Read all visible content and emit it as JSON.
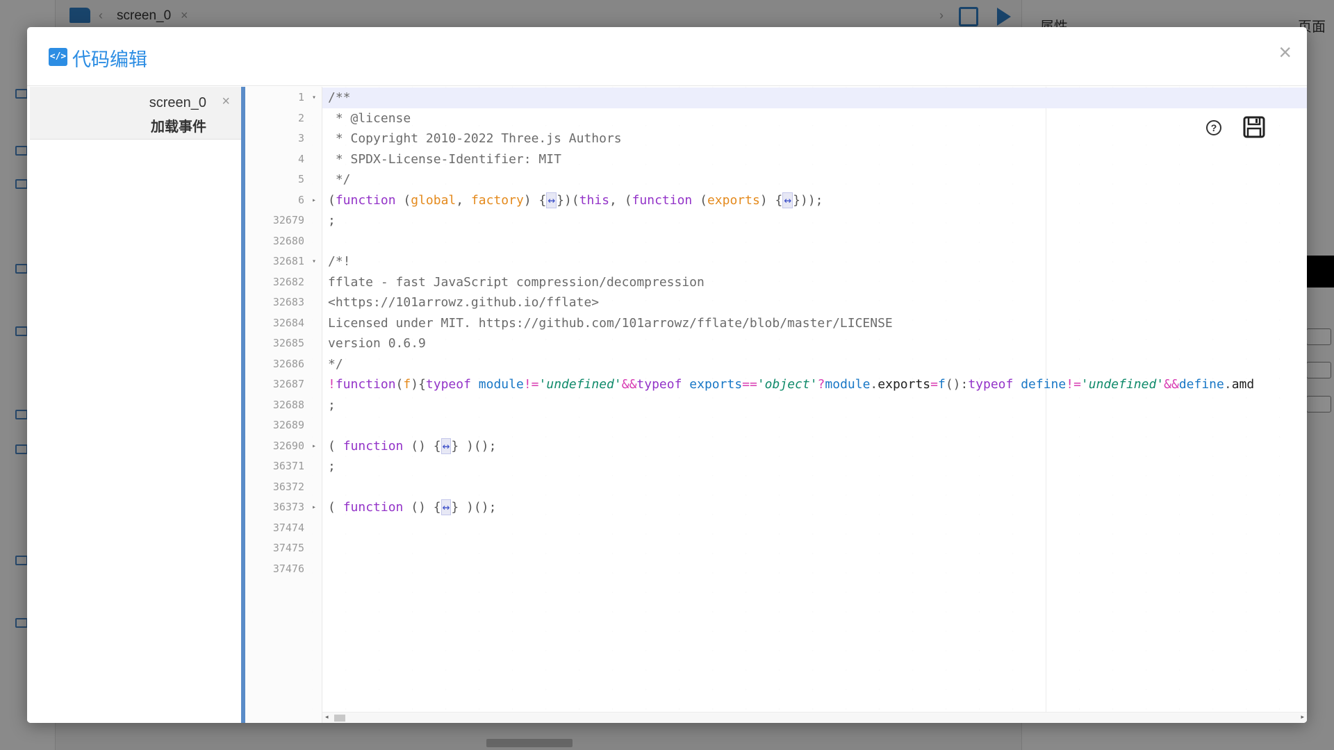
{
  "background_app": {
    "tab_label": "screen_0",
    "right_panel_title": "属性",
    "right_panel_tab": "页面"
  },
  "modal": {
    "title": "代码编辑",
    "title_icon": "code-icon",
    "close_label": "×"
  },
  "script_list": [
    {
      "name": "screen_0",
      "event": "加载事件",
      "close_label": "×"
    }
  ],
  "editor": {
    "lines": [
      {
        "num": "1",
        "fold": "open",
        "tokens": [
          [
            "c-com",
            "/**"
          ]
        ]
      },
      {
        "num": "2",
        "tokens": [
          [
            "c-com",
            " * @license"
          ]
        ]
      },
      {
        "num": "3",
        "tokens": [
          [
            "c-com",
            " * Copyright 2010-2022 Three.js Authors"
          ]
        ]
      },
      {
        "num": "4",
        "tokens": [
          [
            "c-com",
            " * SPDX-License-Identifier: MIT"
          ]
        ]
      },
      {
        "num": "5",
        "tokens": [
          [
            "c-com",
            " */"
          ]
        ]
      },
      {
        "num": "6",
        "fold": "closed",
        "tokens": [
          [
            "c-plain",
            "("
          ],
          [
            "c-kw",
            "function"
          ],
          [
            "c-plain",
            " ("
          ],
          [
            "c-par",
            "global"
          ],
          [
            "c-plain",
            ", "
          ],
          [
            "c-par",
            "factory"
          ],
          [
            "c-plain",
            ") {"
          ],
          [
            "c-fold",
            "↔"
          ],
          [
            "c-plain",
            "})("
          ],
          [
            "c-kw",
            "this"
          ],
          [
            "c-plain",
            ", ("
          ],
          [
            "c-kw",
            "function"
          ],
          [
            "c-plain",
            " ("
          ],
          [
            "c-par",
            "exports"
          ],
          [
            "c-plain",
            ") {"
          ],
          [
            "c-fold",
            "↔"
          ],
          [
            "c-plain",
            "}));"
          ]
        ]
      },
      {
        "num": "32679",
        "tokens": [
          [
            "c-plain",
            ";"
          ]
        ]
      },
      {
        "num": "32680",
        "tokens": []
      },
      {
        "num": "32681",
        "fold": "open",
        "tokens": [
          [
            "c-com",
            "/*!"
          ]
        ]
      },
      {
        "num": "32682",
        "tokens": [
          [
            "c-com",
            "fflate - fast JavaScript compression/decompression"
          ]
        ]
      },
      {
        "num": "32683",
        "tokens": [
          [
            "c-com",
            "<https://101arrowz.github.io/fflate>"
          ]
        ]
      },
      {
        "num": "32684",
        "tokens": [
          [
            "c-com",
            "Licensed under MIT. https://github.com/101arrowz/fflate/blob/master/LICENSE"
          ]
        ]
      },
      {
        "num": "32685",
        "tokens": [
          [
            "c-com",
            "version 0.6.9"
          ]
        ]
      },
      {
        "num": "32686",
        "tokens": [
          [
            "c-com",
            "*/"
          ]
        ]
      },
      {
        "num": "32687",
        "tokens": [
          [
            "c-op",
            "!"
          ],
          [
            "c-kw",
            "function"
          ],
          [
            "c-plain",
            "("
          ],
          [
            "c-par",
            "f"
          ],
          [
            "c-plain",
            "){"
          ],
          [
            "c-kw",
            "typeof"
          ],
          [
            "c-plain",
            " "
          ],
          [
            "c-id",
            "module"
          ],
          [
            "c-op",
            "!="
          ],
          [
            "c-str",
            "'undefined'"
          ],
          [
            "c-op",
            "&&"
          ],
          [
            "c-kw",
            "typeof"
          ],
          [
            "c-plain",
            " "
          ],
          [
            "c-id",
            "exports"
          ],
          [
            "c-op",
            "=="
          ],
          [
            "c-str",
            "'object'"
          ],
          [
            "c-op",
            "?"
          ],
          [
            "c-id",
            "module"
          ],
          [
            "c-plain",
            "."
          ],
          [
            "c-blk",
            "exports"
          ],
          [
            "c-op",
            "="
          ],
          [
            "c-id",
            "f"
          ],
          [
            "c-plain",
            "():"
          ],
          [
            "c-kw",
            "typeof"
          ],
          [
            "c-plain",
            " "
          ],
          [
            "c-id",
            "define"
          ],
          [
            "c-op",
            "!="
          ],
          [
            "c-str",
            "'undefined'"
          ],
          [
            "c-op",
            "&&"
          ],
          [
            "c-id",
            "define"
          ],
          [
            "c-plain",
            "."
          ],
          [
            "c-blk",
            "amd"
          ]
        ]
      },
      {
        "num": "32688",
        "tokens": [
          [
            "c-plain",
            ";"
          ]
        ]
      },
      {
        "num": "32689",
        "tokens": []
      },
      {
        "num": "32690",
        "fold": "closed",
        "tokens": [
          [
            "c-plain",
            "( "
          ],
          [
            "c-kw",
            "function"
          ],
          [
            "c-plain",
            " () {"
          ],
          [
            "c-fold",
            "↔"
          ],
          [
            "c-plain",
            "} )();"
          ]
        ]
      },
      {
        "num": "36371",
        "tokens": [
          [
            "c-plain",
            ";"
          ]
        ]
      },
      {
        "num": "36372",
        "tokens": []
      },
      {
        "num": "36373",
        "fold": "closed",
        "tokens": [
          [
            "c-plain",
            "( "
          ],
          [
            "c-kw",
            "function"
          ],
          [
            "c-plain",
            " () {"
          ],
          [
            "c-fold",
            "↔"
          ],
          [
            "c-plain",
            "} )();"
          ]
        ]
      },
      {
        "num": "37474",
        "tokens": []
      },
      {
        "num": "37475",
        "tokens": []
      },
      {
        "num": "37476",
        "tokens": []
      }
    ],
    "active_line_index": 0,
    "help_icon": "help-circle-icon",
    "help_label": "?",
    "save_icon": "save-icon"
  },
  "colors": {
    "accent": "#2c8de3",
    "divider": "#5a8cc8",
    "keyword": "#9333c8",
    "param": "#e48a1d",
    "string": "#0f8a6a"
  }
}
